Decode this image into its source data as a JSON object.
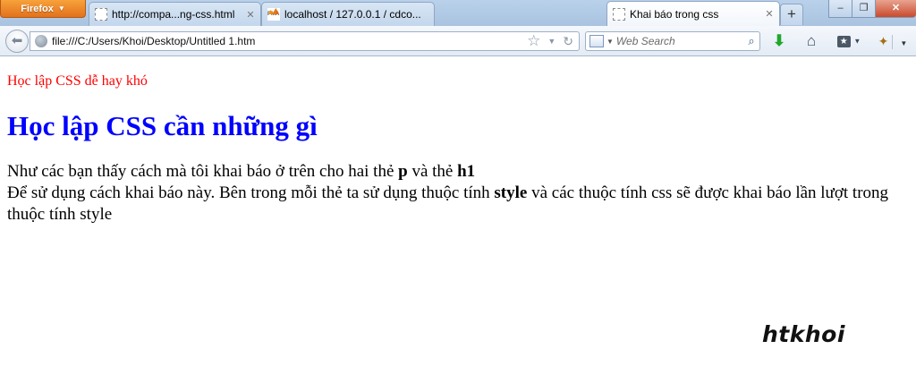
{
  "browser": {
    "menu_button": "Firefox",
    "tabs": [
      {
        "label": "http://compa...ng-css.html",
        "favicon": "blank-page-icon"
      },
      {
        "label": "localhost / 127.0.0.1 / cdco...",
        "favicon": "phpmyadmin-icon"
      },
      {
        "label": "Khai báo trong css",
        "favicon": "blank-page-icon"
      }
    ],
    "new_tab": "+",
    "window_controls": {
      "minimize": "–",
      "restore": "❐",
      "close": "✕"
    }
  },
  "navbar": {
    "url": "file:///C:/Users/Khoi/Desktop/Untitled 1.htm",
    "search_placeholder": "Web Search"
  },
  "page": {
    "intro": "Học lập CSS dễ hay khó",
    "heading": "Học lập CSS cần những gì",
    "line1_prefix": "Như các bạn thấy cách mà tôi khai báo ở trên cho hai thẻ ",
    "line1_tag1": "p",
    "line1_mid": " và thẻ ",
    "line1_tag2": "h1",
    "line2_prefix": "Để sử dụng cách khai báo này. Bên trong mỗi thẻ ta sử dụng thuộc tính ",
    "line2_attr": "style",
    "line2_suffix": " và các thuộc tính css sẽ được khai báo lần lượt trong thuộc tính style",
    "watermark": "htkhoi"
  },
  "colors": {
    "intro_text": "#ff0000",
    "heading_text": "#0000ff",
    "firefox_button": "#e2711d"
  }
}
